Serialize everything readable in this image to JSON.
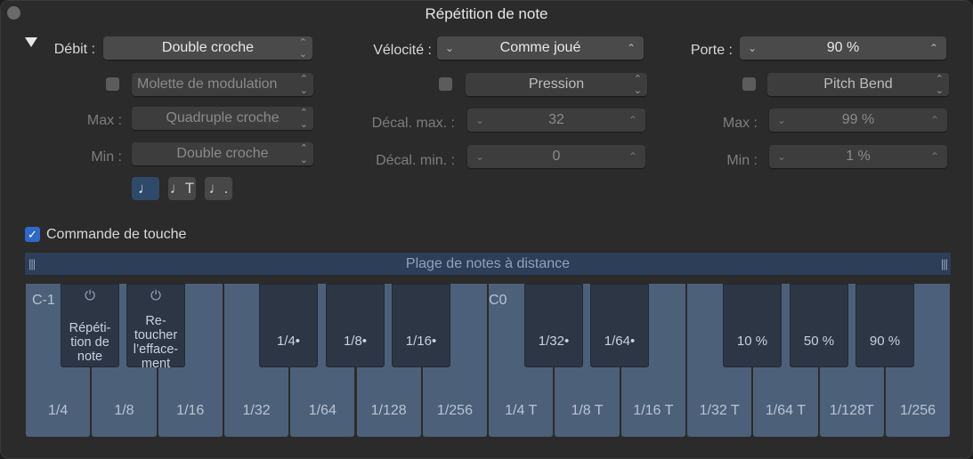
{
  "window": {
    "title": "Répétition de note"
  },
  "rate": {
    "label": "Débit :",
    "value": "Double croche",
    "mod_source": "Molette de modulation",
    "max_label": "Max :",
    "max_value": "Quadruple croche",
    "min_label": "Min :",
    "min_value": "Double croche",
    "note_buttons": [
      "♩",
      "♩T",
      "♩."
    ],
    "selected_note_button": 0
  },
  "velocity": {
    "label": "Vélocité :",
    "value": "Comme joué",
    "mod_source": "Pression",
    "max_label": "Décal. max. :",
    "max_value": "32",
    "min_label": "Décal. min. :",
    "min_value": "0"
  },
  "gate": {
    "label": "Porte :",
    "value": "90 %",
    "mod_source": "Pitch Bend",
    "max_label": "Max :",
    "max_value": "99 %",
    "min_label": "Min :",
    "min_value": "1 %"
  },
  "key_commands": {
    "label": "Commande de touche",
    "checked": true
  },
  "range_bar": {
    "label": "Plage de notes à distance",
    "grip": "|||"
  },
  "keyboard": {
    "octaves": [
      "C-1",
      "C0"
    ],
    "white_keys": [
      "1/4",
      "1/8",
      "1/16",
      "1/32",
      "1/64",
      "1/128",
      "1/256",
      "1/4 T",
      "1/8 T",
      "1/16 T",
      "1/32 T",
      "1/64 T",
      "1/128T",
      "1/256"
    ],
    "black_keys": [
      {
        "icon": "power-icon",
        "label": "Répéti-\ntion de\nnote"
      },
      {
        "icon": "power-icon",
        "label": "Re-\ntoucher\nl’efface-\nment"
      },
      {
        "label": "1/4•"
      },
      {
        "label": "1/8•"
      },
      {
        "label": "1/16•"
      },
      {
        "label": "1/32•"
      },
      {
        "label": "1/64•"
      },
      {
        "label": "10 %"
      },
      {
        "label": "50 %"
      },
      {
        "label": "90 %"
      }
    ]
  },
  "colors": {
    "accent": "#2e69c9",
    "key_white": "#4d6079",
    "key_black": "#2d3644",
    "range_bar": "#2c3e58"
  }
}
